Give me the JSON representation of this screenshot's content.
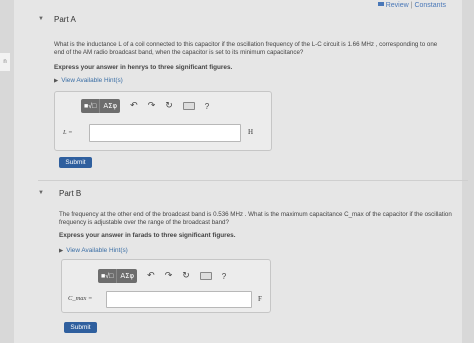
{
  "edge_tab": "n",
  "header": {
    "review_label": "Review",
    "separator": "|",
    "constants_label": "Constants"
  },
  "part_a": {
    "title": "Part A",
    "question_line1": "What is the inductance L of a coil connected to this capacitor if the oscillation frequency of the L-C circuit is 1.66 MHz , corresponding to one",
    "question_line2": "end of the AM radio broadcast band, when the capacitor is set to its minimum capacitance?",
    "instruction": "Express your answer in henrys to three significant figures.",
    "hint_label": "View Available Hint(s)",
    "toolbar": {
      "templates": "■√□",
      "greek": "ΑΣφ",
      "undo": "↶",
      "redo": "↷",
      "reset": "↻",
      "help": "?"
    },
    "variable_label": "L =",
    "input_value": "",
    "unit": "H",
    "submit_label": "Submit"
  },
  "part_b": {
    "title": "Part B",
    "question_line1": "The frequency at the other end of the broadcast band is 0.536 MHz . What is the maximum capacitance C_max of the capacitor if the oscillation",
    "question_line2": "frequency is adjustable over the range of the broadcast band?",
    "instruction": "Express your answer in farads to three significant figures.",
    "hint_label": "View Available Hint(s)",
    "toolbar": {
      "templates": "■√□",
      "greek": "ΑΣφ",
      "undo": "↶",
      "redo": "↷",
      "reset": "↻",
      "help": "?"
    },
    "variable_label": "C_max =",
    "input_value": "",
    "unit": "F",
    "submit_label": "Submit"
  },
  "colors": {
    "link": "#3a6ea5",
    "submit_bg": "#2f5f9e",
    "toolbar_bg": "#6d6d6d"
  }
}
